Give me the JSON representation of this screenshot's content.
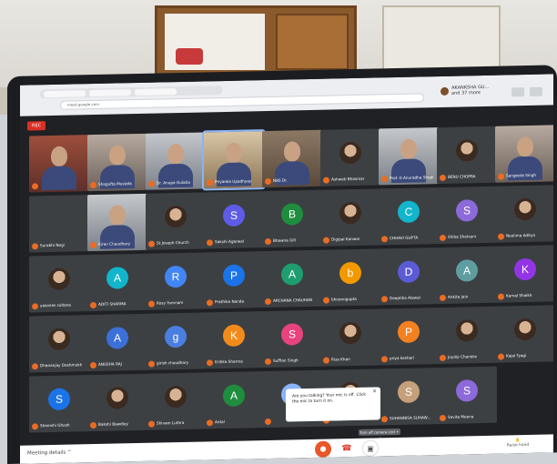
{
  "browser": {
    "address": "meet.google.com",
    "profile_name": "AKANKSHA GU...",
    "profile_sub": "and 37 more"
  },
  "meeting": {
    "rec_label": "REC",
    "details_label": "Meeting details ^",
    "raise_hand_label": "Raise hand",
    "popup_text": "Are you talking? Your mic is off. Click the mic to turn it on.",
    "popup_close": "×",
    "tooltip_text": "Turn off camera (ctrl + e)"
  },
  "participants": [
    {
      "name": "",
      "kind": "video",
      "style": "vid4"
    },
    {
      "name": "Shagufta Mustafa",
      "kind": "video",
      "style": "vid2"
    },
    {
      "name": "Dr. Anupa Gulatia",
      "kind": "video",
      "style": "vid5"
    },
    {
      "name": "Priyanka Upadhyay",
      "kind": "video",
      "style": "vid3",
      "speaking": true
    },
    {
      "name": "NBS Dr.",
      "kind": "video",
      "style": "video"
    },
    {
      "name": "Ashwati Bhasmar",
      "kind": "photo"
    },
    {
      "name": "Prof. G Anuradha Singh",
      "kind": "video",
      "style": "vid5"
    },
    {
      "name": "BENU CHOPRA",
      "kind": "photo"
    },
    {
      "name": "Sangeeta Singh",
      "kind": "video",
      "style": "vid2"
    },
    {
      "name": "Surabhi Negi",
      "kind": "empty"
    },
    {
      "name": "Kiran Chaudhary",
      "kind": "video",
      "style": "vid5"
    },
    {
      "name": "St.Joseph Church",
      "kind": "photo"
    },
    {
      "name": "Sakshi Agarwal",
      "kind": "letter",
      "letter": "S",
      "color": "#5e5ce6"
    },
    {
      "name": "Bhawna Gill",
      "kind": "letter",
      "letter": "B",
      "color": "#1e8e3e"
    },
    {
      "name": "Digipal Kanwar",
      "kind": "photo"
    },
    {
      "name": "CHHAVI GUPTA",
      "kind": "letter",
      "letter": "C",
      "color": "#12b5cb"
    },
    {
      "name": "Shiba Shelvani",
      "kind": "letter",
      "letter": "S",
      "color": "#8c6ad9"
    },
    {
      "name": "Neelima Aditya",
      "kind": "photo"
    },
    {
      "name": "yasonas sultana",
      "kind": "photo"
    },
    {
      "name": "ADITI SHARMA",
      "kind": "letter",
      "letter": "A",
      "color": "#12b5cb"
    },
    {
      "name": "Rosy Yumnam",
      "kind": "letter",
      "letter": "R",
      "color": "#4285f4"
    },
    {
      "name": "Prathika Nanda",
      "kind": "letter",
      "letter": "P",
      "color": "#1a73e8"
    },
    {
      "name": "ARCHANA CHAUHAN",
      "kind": "letter",
      "letter": "A",
      "color": "#1e9e6e"
    },
    {
      "name": "bhoomigupta",
      "kind": "letter",
      "letter": "b",
      "color": "#f29900"
    },
    {
      "name": "Deeptika Alawal",
      "kind": "letter",
      "letter": "D",
      "color": "#5b5bd6"
    },
    {
      "name": "Ankita Jain",
      "kind": "letter",
      "letter": "A",
      "color": "#5f9ea0"
    },
    {
      "name": "Kamal Shaikh",
      "kind": "letter",
      "letter": "K",
      "color": "#9334e6"
    },
    {
      "name": "Dhananjay Deshmukh",
      "kind": "photo"
    },
    {
      "name": "ANUSHA RAJ",
      "kind": "letter",
      "letter": "A",
      "color": "#3c6fd8"
    },
    {
      "name": "girish choudhary",
      "kind": "letter",
      "letter": "g",
      "color": "#4a7fe0"
    },
    {
      "name": "Kritika Sharma",
      "kind": "letter",
      "letter": "K",
      "color": "#f28b1c"
    },
    {
      "name": "Suffian Singh",
      "kind": "letter",
      "letter": "S",
      "color": "#e8437d"
    },
    {
      "name": "Riza Khan",
      "kind": "photo"
    },
    {
      "name": "priya keshari",
      "kind": "letter",
      "letter": "P",
      "color": "#f4811f"
    },
    {
      "name": "Joydip Chandra",
      "kind": "photo"
    },
    {
      "name": "Kajal Tyagi",
      "kind": "photo"
    },
    {
      "name": "Shamshi Ghosh",
      "kind": "letter",
      "letter": "S",
      "color": "#1a73e8"
    },
    {
      "name": "Bakshi Bawdley",
      "kind": "photo"
    },
    {
      "name": "Shivam Luthra",
      "kind": "photo"
    },
    {
      "name": "Antal",
      "kind": "letter",
      "letter": "A",
      "color": "#1e8e3e"
    },
    {
      "name": "",
      "kind": "letter",
      "letter": "T",
      "color": "#8ab4f8"
    },
    {
      "name": "Neeta Mishra",
      "kind": "photo"
    },
    {
      "name": "SUHANNISA SUHAW...",
      "kind": "letter",
      "letter": "S",
      "color": "#c5a07a"
    },
    {
      "name": "Savita Meena",
      "kind": "letter",
      "letter": "S",
      "color": "#8c6ad9"
    }
  ]
}
